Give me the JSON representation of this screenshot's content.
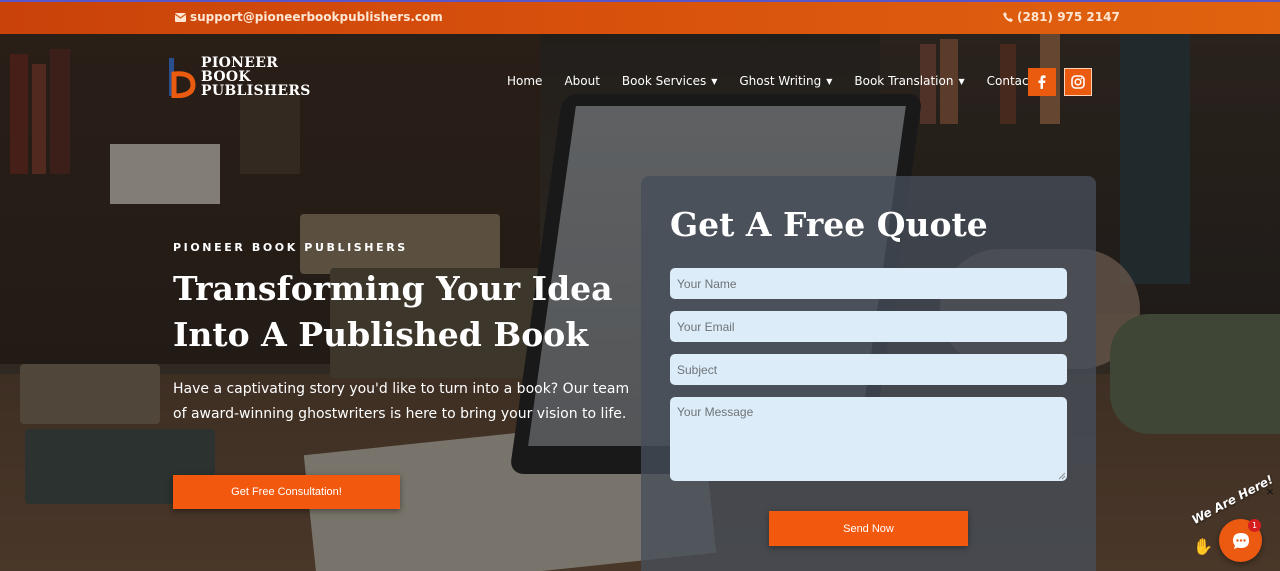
{
  "topbar": {
    "email": "support@pioneerbookpublishers.com",
    "phone": "(281) 975 2147"
  },
  "logo": {
    "line1": "PIONEER",
    "line2": "BOOK",
    "line3": "PUBLISHERS"
  },
  "nav": {
    "items": [
      {
        "label": "Home",
        "has_dropdown": false
      },
      {
        "label": "About",
        "has_dropdown": false
      },
      {
        "label": "Book Services",
        "has_dropdown": true
      },
      {
        "label": "Ghost Writing",
        "has_dropdown": true
      },
      {
        "label": "Book Translation",
        "has_dropdown": true
      },
      {
        "label": "Contact",
        "has_dropdown": false
      }
    ],
    "social": [
      "facebook-icon",
      "instagram-icon"
    ]
  },
  "hero": {
    "eyebrow": "PIONEER BOOK PUBLISHERS",
    "headline_line1": "Transforming Your Idea",
    "headline_line2": "Into A Published Book",
    "lead": "Have a captivating story you'd like to turn into a book? Our team of award-winning ghostwriters is here to bring your vision to life.",
    "cta_label": "Get Free Consultation!"
  },
  "form": {
    "title": "Get A Free Quote",
    "name_placeholder": "Your Name",
    "email_placeholder": "Your Email",
    "subject_placeholder": "Subject",
    "message_placeholder": "Your Message",
    "submit_label": "Send Now"
  },
  "chat": {
    "tag": "We Are Here!",
    "badge_count": "1",
    "close": "×"
  },
  "colors": {
    "accent": "#f2590f",
    "topbar": "#d9520c",
    "field_bg": "#dcecf8"
  }
}
